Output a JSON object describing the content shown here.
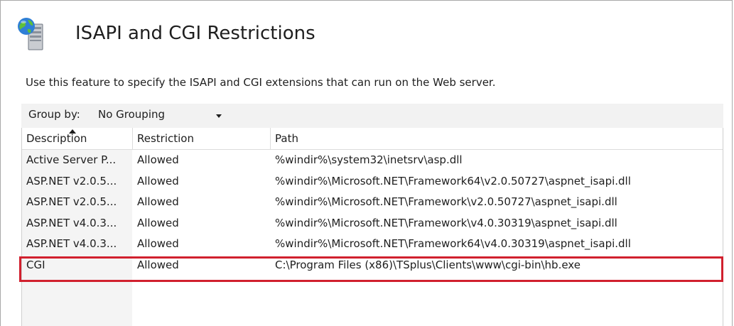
{
  "page": {
    "title": "ISAPI and CGI Restrictions",
    "description": "Use this feature to specify the ISAPI and CGI extensions that can run on the Web server.",
    "icon": "server-globe-icon"
  },
  "group_by": {
    "label": "Group by:",
    "value": "No Grouping"
  },
  "table": {
    "columns": [
      "Description",
      "Restriction",
      "Path"
    ],
    "sorted_column": "Description",
    "rows": [
      {
        "description": "Active Server P...",
        "restriction": "Allowed",
        "path": "%windir%\\system32\\inetsrv\\asp.dll"
      },
      {
        "description": "ASP.NET v2.0.5...",
        "restriction": "Allowed",
        "path": "%windir%\\Microsoft.NET\\Framework64\\v2.0.50727\\aspnet_isapi.dll"
      },
      {
        "description": "ASP.NET v2.0.5...",
        "restriction": "Allowed",
        "path": "%windir%\\Microsoft.NET\\Framework\\v2.0.50727\\aspnet_isapi.dll"
      },
      {
        "description": "ASP.NET v4.0.3...",
        "restriction": "Allowed",
        "path": "%windir%\\Microsoft.NET\\Framework\\v4.0.30319\\aspnet_isapi.dll"
      },
      {
        "description": "ASP.NET v4.0.3...",
        "restriction": "Allowed",
        "path": "%windir%\\Microsoft.NET\\Framework64\\v4.0.30319\\aspnet_isapi.dll"
      },
      {
        "description": "CGI",
        "restriction": "Allowed",
        "path": "C:\\Program Files (x86)\\TSplus\\Clients\\www\\cgi-bin\\hb.exe"
      }
    ]
  },
  "colors": {
    "highlight_border": "#d1202e",
    "groupby_bar": "#f2f2f2"
  }
}
